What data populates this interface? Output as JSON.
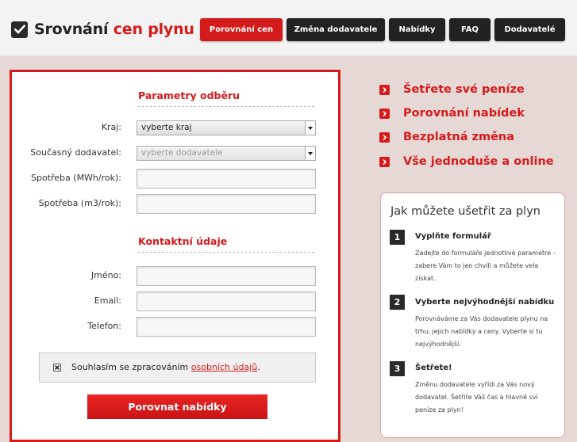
{
  "header": {
    "logo_part1": "Srovnání",
    "logo_part2": "cen plynu",
    "nav": [
      {
        "label": "Porovnání cen",
        "active": true
      },
      {
        "label": "Změna dodavatele",
        "active": false
      },
      {
        "label": "Nabídky",
        "active": false
      },
      {
        "label": "FAQ",
        "active": false
      },
      {
        "label": "Dodavatelé",
        "active": false
      }
    ]
  },
  "form": {
    "params_title": "Parametry odběru",
    "region_label": "Kraj:",
    "region_value": "vyberte kraj",
    "supplier_label": "Současný dodavatel:",
    "supplier_value": "vyberte dodavatele",
    "consumption_mwh_label": "Spotřeba (MWh/rok):",
    "consumption_m3_label": "Spotřeba (m3/rok):",
    "contact_title": "Kontaktní údaje",
    "name_label": "Jméno:",
    "email_label": "Email:",
    "phone_label": "Telefon:",
    "consent_text": "Souhlasím se zpracováním",
    "consent_link": "osobních údajů",
    "consent_end": ".",
    "consent_checked": true,
    "submit_label": "Porovnat nabídky"
  },
  "benefits": [
    "Šetřete své peníze",
    "Porovnání nabídek",
    "Bezplatná změna",
    "Vše jednoduše a online"
  ],
  "steps": {
    "title": "Jak můžete ušetřit za plyn",
    "items": [
      {
        "num": "1",
        "title": "Vyplňte formulář",
        "text": "Zadejte do formuláře jednotlivé parametre – zabere Vám to jen chvíli a můžete vela získat."
      },
      {
        "num": "2",
        "title": "Vyberte nejvýhodnější nabídku",
        "text": "Porovnáváme za Vás dodavatele plynu na trhu, jejich nabídky a ceny. Vyberte si tu nejvýhodnější."
      },
      {
        "num": "3",
        "title": "Šetřete!",
        "text": "Změnu dodavatele vyřídí za Vás nový dodavatel. Šetřite Váš čas a hlavně sví peníze za plyn!"
      }
    ]
  },
  "colors": {
    "accent": "#d41b1b",
    "dark": "#222222",
    "background": "#e6d8d5"
  }
}
